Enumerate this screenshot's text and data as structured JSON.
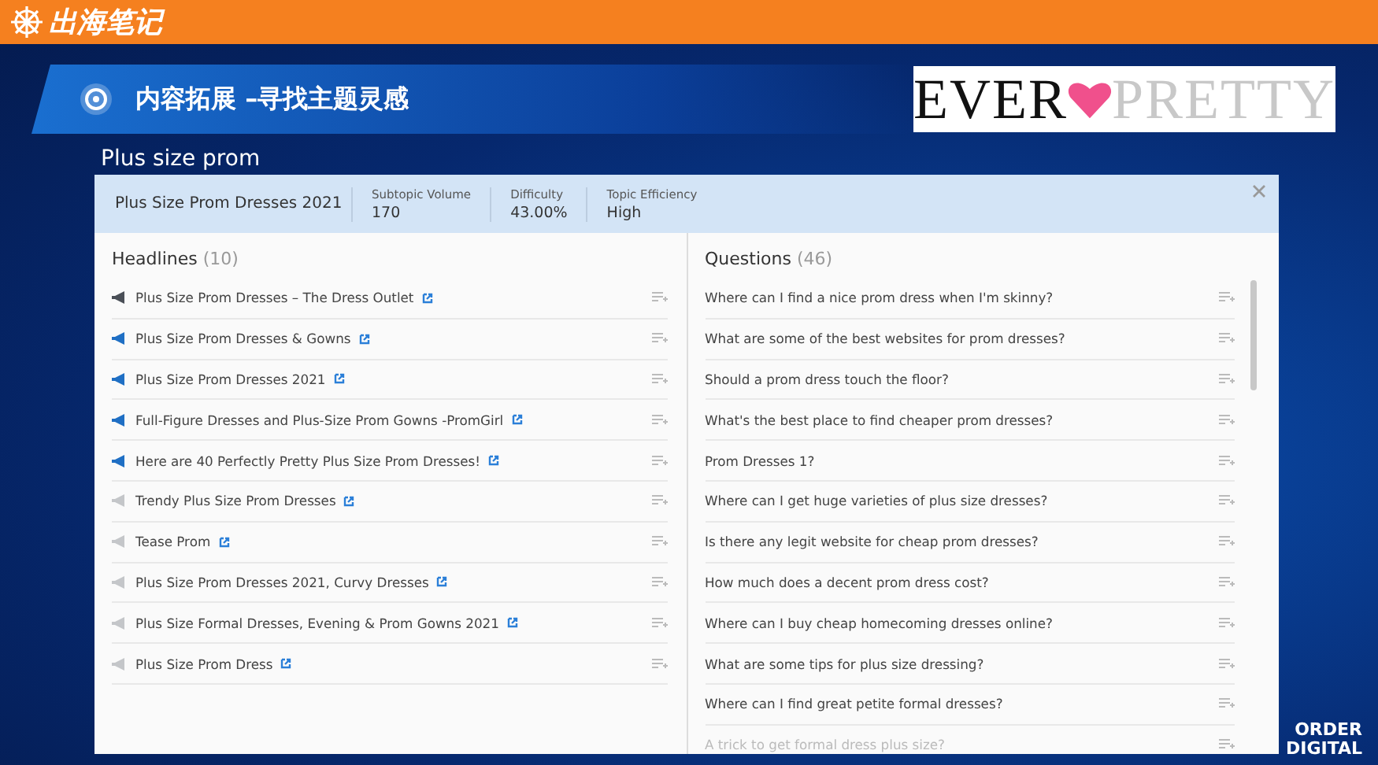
{
  "top_bar": {
    "logo": "出海笔记"
  },
  "slide": {
    "title": "内容拓展 –寻找主题灵感",
    "brand_logo": {
      "left": "EVER",
      "right": "PRETTY"
    },
    "subtitle": "Plus size prom"
  },
  "topic_card": {
    "topic": "Plus Size Prom Dresses 2021",
    "metrics": [
      {
        "label": "Subtopic Volume",
        "value": "170"
      },
      {
        "label": "Difficulty",
        "value": "43.00%"
      },
      {
        "label": "Topic Efficiency",
        "value": "High"
      }
    ],
    "headlines": {
      "title": "Headlines",
      "count": "(10)",
      "items": [
        {
          "text": "Plus Size Prom Dresses – The Dress Outlet",
          "color": "#4a4f57"
        },
        {
          "text": "Plus Size Prom Dresses & Gowns",
          "color": "#1f6fc4"
        },
        {
          "text": "Plus Size Prom Dresses 2021",
          "color": "#1f6fc4"
        },
        {
          "text": "Full-Figure Dresses and Plus-Size Prom Gowns -PromGirl",
          "color": "#1f6fc4"
        },
        {
          "text": "Here are 40 Perfectly Pretty Plus Size Prom Dresses!",
          "color": "#1f6fc4"
        },
        {
          "text": "Trendy Plus Size Prom Dresses",
          "color": "#c4c6c9"
        },
        {
          "text": "Tease Prom",
          "color": "#c4c6c9"
        },
        {
          "text": "Plus Size Prom Dresses 2021, Curvy Dresses",
          "color": "#c4c6c9"
        },
        {
          "text": "Plus Size Formal Dresses, Evening & Prom Gowns 2021",
          "color": "#c4c6c9"
        },
        {
          "text": "Plus Size Prom Dress",
          "color": "#c4c6c9"
        }
      ]
    },
    "questions": {
      "title": "Questions",
      "count": "(46)",
      "items": [
        "Where can I find a nice prom dress when I'm skinny?",
        "What are some of the best websites for prom dresses?",
        "Should a prom dress touch the floor?",
        "What's the best place to find cheaper prom dresses?",
        "Prom Dresses 1?",
        "Where can I get huge varieties of plus size dresses?",
        "Is there any legit website for cheap prom dresses?",
        "How much does a decent prom dress cost?",
        "Where can I buy cheap homecoming dresses online?",
        "What are some tips for plus size dressing?",
        "Where can I find great petite formal dresses?",
        "A trick to get formal dress plus size?"
      ]
    }
  },
  "corner_logo": [
    "ORDER",
    "DIGITAL"
  ]
}
